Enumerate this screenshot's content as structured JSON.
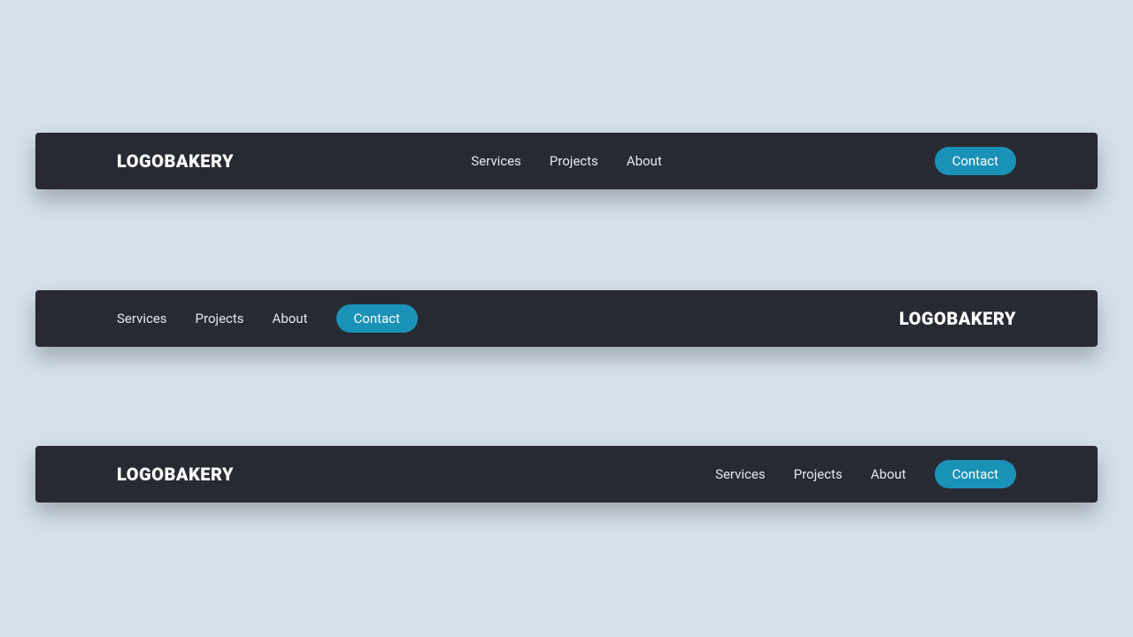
{
  "brand": "LOGOBAKERY",
  "nav": {
    "services": "Services",
    "projects": "Projects",
    "about": "About",
    "contact": "Contact"
  }
}
